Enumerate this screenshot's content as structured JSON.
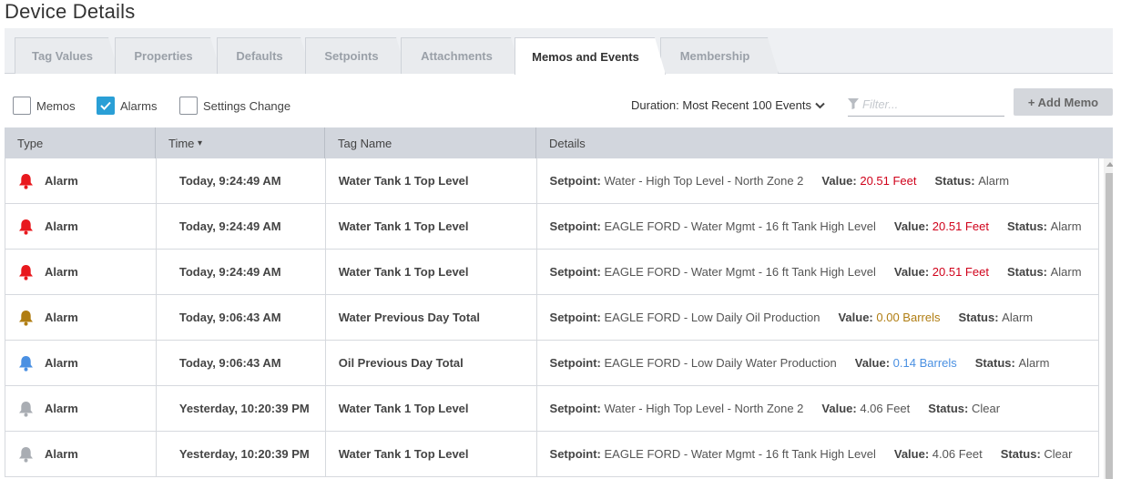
{
  "page": {
    "title": "Device Details"
  },
  "tabs": [
    {
      "label": "Tag Values",
      "active": false
    },
    {
      "label": "Properties",
      "active": false
    },
    {
      "label": "Defaults",
      "active": false
    },
    {
      "label": "Setpoints",
      "active": false
    },
    {
      "label": "Attachments",
      "active": false
    },
    {
      "label": "Memos and Events",
      "active": true
    },
    {
      "label": "Membership",
      "active": false
    }
  ],
  "filters": {
    "memos": {
      "label": "Memos",
      "checked": false
    },
    "alarms": {
      "label": "Alarms",
      "checked": true
    },
    "settings_change": {
      "label": "Settings Change",
      "checked": false
    },
    "duration_label": "Duration:",
    "duration_value": "Most Recent 100 Events",
    "filter_placeholder": "Filter...",
    "add_memo_label": "+ Add Memo"
  },
  "table": {
    "columns": [
      "Type",
      "Time",
      "Tag Name",
      "Details"
    ],
    "sort_indicator": "▾",
    "rows": [
      {
        "bell_color": "#e8191e",
        "type": "Alarm",
        "time": "Today, 9:24:49 AM",
        "tag": "Water Tank 1 Top Level",
        "setpoint": "Water - High Top Level - North Zone 2",
        "value": "20.51 Feet",
        "value_color": "#d0021b",
        "status": "Alarm"
      },
      {
        "bell_color": "#e8191e",
        "type": "Alarm",
        "time": "Today, 9:24:49 AM",
        "tag": "Water Tank 1 Top Level",
        "setpoint": "EAGLE FORD - Water Mgmt - 16 ft Tank High Level",
        "value": "20.51 Feet",
        "value_color": "#d0021b",
        "status": "Alarm"
      },
      {
        "bell_color": "#e8191e",
        "type": "Alarm",
        "time": "Today, 9:24:49 AM",
        "tag": "Water Tank 1 Top Level",
        "setpoint": "EAGLE FORD - Water Mgmt - 16 ft Tank High Level",
        "value": "20.51 Feet",
        "value_color": "#d0021b",
        "status": "Alarm"
      },
      {
        "bell_color": "#b07d12",
        "type": "Alarm",
        "time": "Today, 9:06:43 AM",
        "tag": "Water Previous Day Total",
        "setpoint": "EAGLE FORD - Low Daily Oil Production",
        "value": "0.00 Barrels",
        "value_color": "#b07d12",
        "status": "Alarm"
      },
      {
        "bell_color": "#4a90e2",
        "type": "Alarm",
        "time": "Today, 9:06:43 AM",
        "tag": "Oil Previous Day Total",
        "setpoint": "EAGLE FORD - Low Daily Water Production",
        "value": "0.14 Barrels",
        "value_color": "#4a90e2",
        "status": "Alarm"
      },
      {
        "bell_color": "#a9adb3",
        "type": "Alarm",
        "time": "Yesterday, 10:20:39 PM",
        "tag": "Water Tank 1 Top Level",
        "setpoint": "Water - High Top Level - North Zone 2",
        "value": "4.06 Feet",
        "value_color": "#555555",
        "status": "Clear"
      },
      {
        "bell_color": "#a9adb3",
        "type": "Alarm",
        "time": "Yesterday, 10:20:39 PM",
        "tag": "Water Tank 1 Top Level",
        "setpoint": "EAGLE FORD - Water Mgmt - 16 ft Tank High Level",
        "value": "4.06 Feet",
        "value_color": "#555555",
        "status": "Clear"
      }
    ],
    "detail_labels": {
      "setpoint": "Setpoint:",
      "value": "Value:",
      "status": "Status:"
    }
  },
  "colors": {
    "accent": "#2a9fd6",
    "header_bg": "#d2d6dd"
  }
}
